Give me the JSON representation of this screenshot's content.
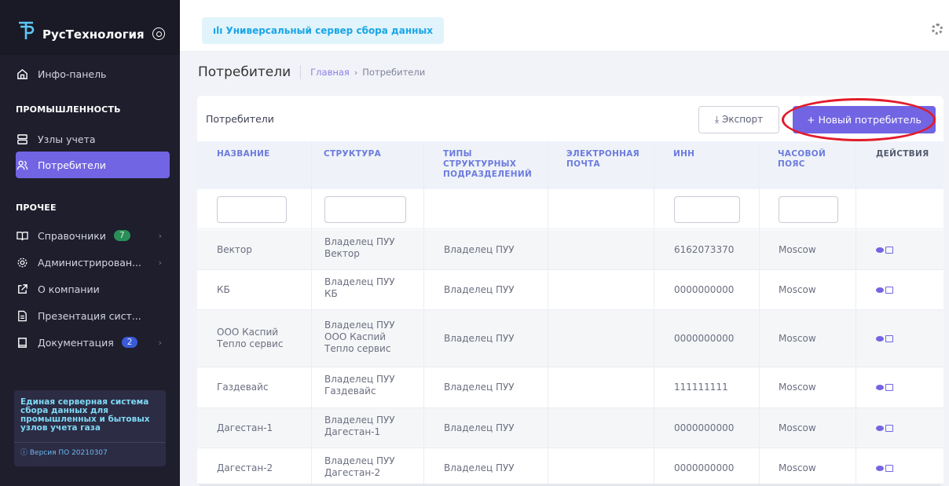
{
  "brand": {
    "name": "РусТехнология"
  },
  "sidebar": {
    "dashboard": "Инфо-панель",
    "section_industry": "ПРОМЫШЛЕННОСТЬ",
    "meters": "Узлы учета",
    "consumers": "Потребители",
    "section_other": "ПРОЧЕЕ",
    "references": "Справочники",
    "references_badge": "7",
    "admin": "Администрирован...",
    "about": "О компании",
    "presentation": "Презентация сист...",
    "docs": "Документация",
    "docs_badge": "2",
    "info_text": "Единая серверная система сбора данных для промышленных и бытовых узлов учета газа",
    "version": "ⓘ Версия ПО 20210307"
  },
  "topbar": {
    "badge": "ılı Универсальный сервер сбора данных"
  },
  "subheader": {
    "title": "Потребители",
    "crumb_home": "Главная",
    "crumb_sep": "›",
    "crumb_current": "Потребители"
  },
  "card": {
    "title": "Потребители",
    "export_label": "⤓ Экспорт",
    "new_label": "+ Новый потребитель"
  },
  "table": {
    "headers": [
      "НАЗВАНИЕ",
      "СТРУКТУРА",
      "ТИПЫ СТРУКТУРНЫХ ПОДРАЗДЕЛЕНИЙ",
      "ЭЛЕКТРОННАЯ ПОЧТА",
      "ИНН",
      "ЧАСОВОЙ ПОЯС",
      "ДЕЙСТВИЯ"
    ],
    "rows": [
      {
        "name": "Вектор",
        "structure": "Владелец ПУУ Вектор",
        "type": "Владелец ПУУ",
        "email": "",
        "inn": "6162073370",
        "tz": "Moscow"
      },
      {
        "name": "КБ",
        "structure": "Владелец ПУУ КБ",
        "type": "Владелец ПУУ",
        "email": "",
        "inn": "0000000000",
        "tz": "Moscow"
      },
      {
        "name": "ООО Каспий Тепло сервис",
        "structure": "Владелец ПУУ ООО Каспий Тепло сервис",
        "type": "Владелец ПУУ",
        "email": "",
        "inn": "0000000000",
        "tz": "Moscow"
      },
      {
        "name": "Газдевайс",
        "structure": "Владелец ПУУ Газдевайс",
        "type": "Владелец ПУУ",
        "email": "",
        "inn": "111111111",
        "tz": "Moscow"
      },
      {
        "name": "Дагестан-1",
        "structure": "Владелец ПУУ Дагестан-1",
        "type": "Владелец ПУУ",
        "email": "",
        "inn": "0000000000",
        "tz": "Moscow"
      },
      {
        "name": "Дагестан-2",
        "structure": "Владелец ПУУ Дагестан-2",
        "type": "Владелец ПУУ",
        "email": "",
        "inn": "0000000000",
        "tz": "Moscow"
      }
    ]
  }
}
